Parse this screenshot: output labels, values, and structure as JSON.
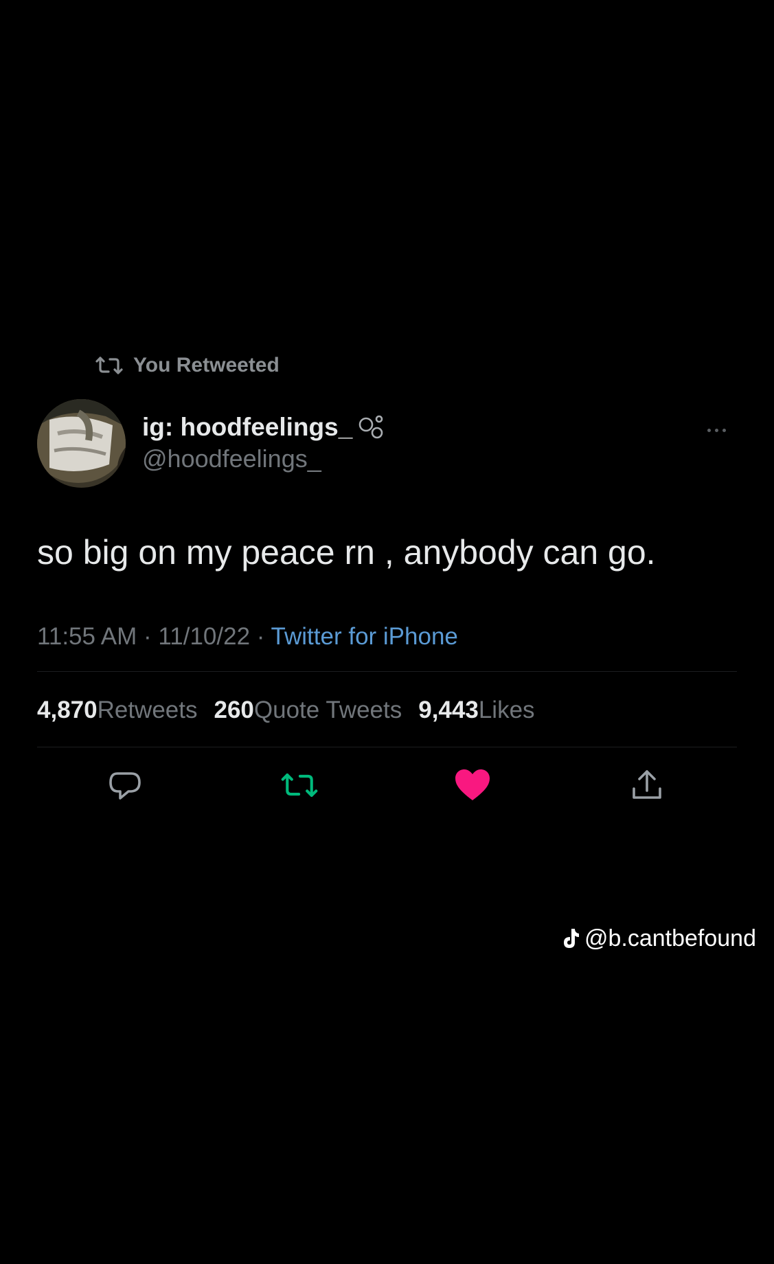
{
  "retweet_context": {
    "label": "You Retweeted",
    "icon": "retweet-icon"
  },
  "author": {
    "display_name": "ig: hoodfeelings_",
    "badge_icon": "circles-badge-icon",
    "handle": "@hoodfeelings_",
    "avatar": "avatar"
  },
  "tweet": {
    "text": "so big on my peace rn , anybody can go.",
    "time": "11:55 AM",
    "separator": "·",
    "date": "11/10/22",
    "source": "Twitter for iPhone"
  },
  "stats": [
    {
      "count": "4,870",
      "label": "Retweets"
    },
    {
      "count": "260",
      "label": "Quote Tweets"
    },
    {
      "count": "9,443",
      "label": "Likes"
    }
  ],
  "actions": [
    {
      "name": "reply",
      "icon": "reply-icon"
    },
    {
      "name": "retweet",
      "icon": "retweet-icon",
      "active": true,
      "color": "#00ba7c"
    },
    {
      "name": "like",
      "icon": "heart-icon",
      "active": true,
      "color": "#f91880"
    },
    {
      "name": "share",
      "icon": "share-icon"
    }
  ],
  "watermark": {
    "icon": "tiktok-icon",
    "text": "@b.cantbefound"
  },
  "colors": {
    "background": "#000000",
    "text_primary": "#e7e9ea",
    "text_secondary": "#71767b",
    "link": "#5b9bd5",
    "retweet_active": "#00ba7c",
    "like_active": "#f91880"
  }
}
